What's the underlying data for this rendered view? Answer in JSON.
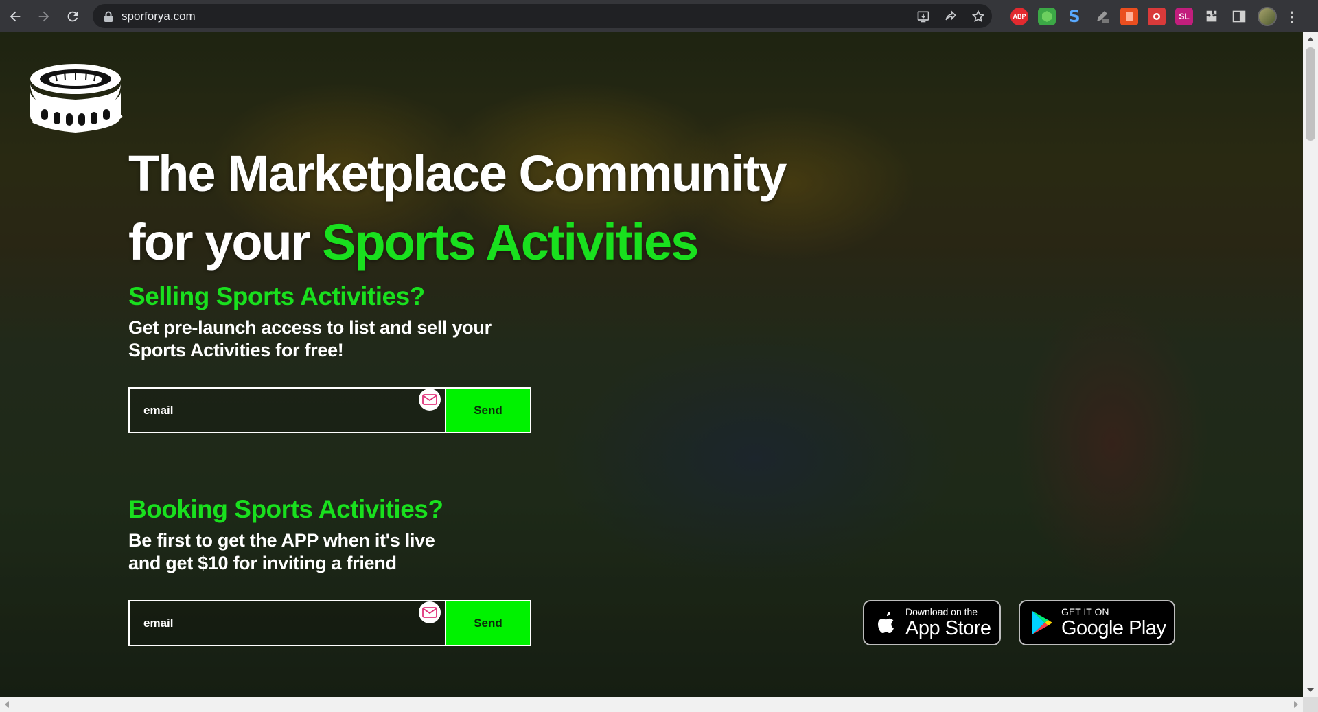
{
  "browser": {
    "url": "sporforya.com",
    "extensions": [
      {
        "name": "adblock-plus-icon",
        "label": "ABP"
      },
      {
        "name": "ghostery-icon",
        "label": ""
      },
      {
        "name": "s-extension-icon",
        "label": "S"
      },
      {
        "name": "pencil-extension-icon",
        "label": ""
      },
      {
        "name": "orange-extension-icon",
        "label": ""
      },
      {
        "name": "camera-extension-icon",
        "label": ""
      },
      {
        "name": "sl-extension-icon",
        "label": "SL"
      }
    ]
  },
  "hero": {
    "headline_line1": "The Marketplace Community",
    "headline_line2_prefix": "for your ",
    "headline_line2_accent": "Sports Activities",
    "colors": {
      "accent": "#19e01e",
      "button": "#00f200",
      "text": "#ffffff"
    }
  },
  "sell": {
    "title": "Selling Sports Activities?",
    "subtitle_line1": "Get pre-launch access to list and sell your",
    "subtitle_line2": "Sports Activities for free!",
    "email_placeholder": "email",
    "send_label": "Send"
  },
  "book": {
    "title": "Booking Sports Activities?",
    "subtitle_line1": "Be first to get the APP when it's live",
    "subtitle_line2": "and get $10 for inviting a friend",
    "email_placeholder": "email",
    "send_label": "Send"
  },
  "stores": {
    "apple_small": "Download on the",
    "apple_big": "App Store",
    "google_small": "GET IT ON",
    "google_big": "Google Play"
  }
}
